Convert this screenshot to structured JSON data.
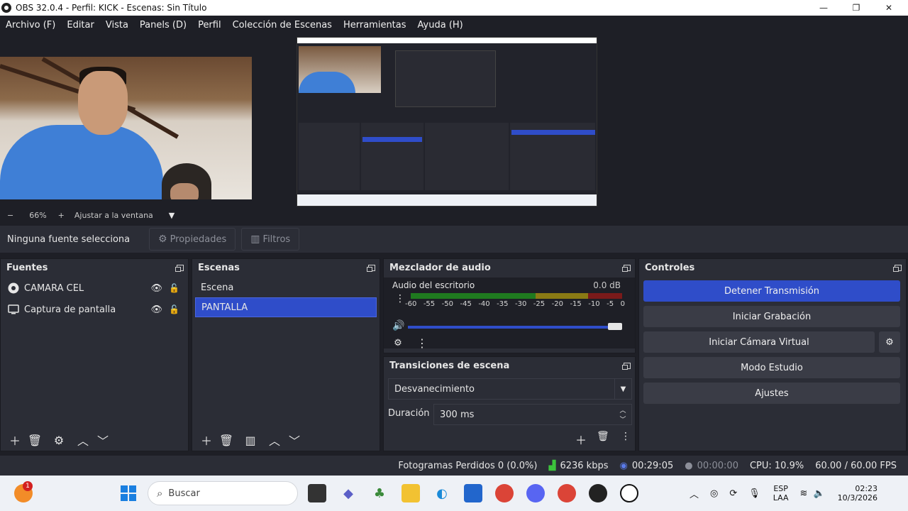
{
  "window": {
    "title": "OBS 32.0.4 - Perfil: KICK - Escenas: Sin Título",
    "minimize": "—",
    "maximize": "❐",
    "close": "✕"
  },
  "menubar": {
    "items": [
      "Archivo (F)",
      "Editar",
      "Vista",
      "Panels (D)",
      "Perfil",
      "Colección de Escenas",
      "Herramientas",
      "Ayuda (H)"
    ]
  },
  "zoom": {
    "minus": "−",
    "level": "66%",
    "plus": "+",
    "fit_label": "Ajustar a la ventana",
    "dropdown": "▼"
  },
  "source_toolbar": {
    "no_selection": "Ninguna fuente selecciona",
    "properties_label": "Propiedades",
    "filters_label": "Filtros"
  },
  "sources": {
    "title": "Fuentes",
    "items": [
      {
        "name": "CAMARA CEL",
        "icon": "camera-icon"
      },
      {
        "name": "Captura de pantalla",
        "icon": "monitor-icon"
      }
    ]
  },
  "scenes": {
    "title": "Escenas",
    "items": [
      {
        "name": "Escena",
        "selected": false
      },
      {
        "name": "PANTALLA",
        "selected": true
      }
    ]
  },
  "mixer": {
    "title": "Mezclador de audio",
    "channel_name": "Audio del escritorio",
    "level": "0.0 dB",
    "ticks": [
      "-60",
      "-55",
      "-50",
      "-45",
      "-40",
      "-35",
      "-30",
      "-25",
      "-20",
      "-15",
      "-10",
      "-5",
      "0"
    ],
    "volume_fraction": 1.0
  },
  "transitions": {
    "title": "Transiciones de escena",
    "selected": "Desvanecimiento",
    "duration_label": "Duración",
    "duration_value": "300 ms"
  },
  "controls": {
    "title": "Controles",
    "stop_stream": "Detener Transmisión",
    "start_recording": "Iniciar Grabación",
    "start_virtual_cam": "Iniciar Cámara Virtual",
    "studio_mode": "Modo Estudio",
    "settings": "Ajustes"
  },
  "status": {
    "dropped_frames": "Fotogramas Perdidos 0 (0.0%)",
    "bitrate": "6236 kbps",
    "stream_time": "00:29:05",
    "record_time": "00:00:00",
    "cpu": "CPU: 10.9%",
    "fps": "60.00 / 60.00 FPS"
  },
  "taskbar": {
    "search_placeholder": "Buscar",
    "notification_count": "1",
    "language": "ESP",
    "layout": "LAA",
    "time": "02:23",
    "date": "10/3/2026"
  },
  "colors": {
    "accent": "#2f4dc9",
    "panel": "#2b2d36",
    "background": "#1e1f26"
  }
}
